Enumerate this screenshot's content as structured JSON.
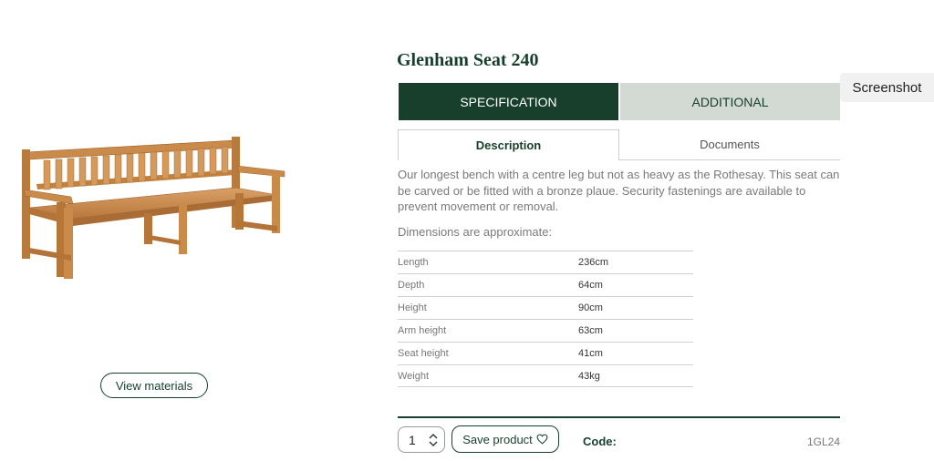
{
  "product": {
    "title": "Glenham Seat 240",
    "image_icon": "teak-bench-image",
    "view_materials_label": "View materials"
  },
  "overlay": {
    "screenshot_label": "Screenshot"
  },
  "tabs": {
    "main": [
      {
        "label": "SPECIFICATION",
        "active": true
      },
      {
        "label": "ADDITIONAL",
        "active": false
      }
    ],
    "sub": [
      {
        "label": "Description",
        "active": true
      },
      {
        "label": "Documents",
        "active": false
      }
    ]
  },
  "description": {
    "text": "Our longest bench with a centre leg but not as heavy as the Rothesay. This seat can be carved or be fitted with a bronze plaue. Security fastenings are available to prevent movement or removal.",
    "dimensions_heading": "Dimensions are approximate:"
  },
  "dimensions": [
    {
      "label": "Length",
      "value": "236cm"
    },
    {
      "label": "Depth",
      "value": "64cm"
    },
    {
      "label": "Height",
      "value": "90cm"
    },
    {
      "label": "Arm height",
      "value": "63cm"
    },
    {
      "label": "Seat height",
      "value": "41cm"
    },
    {
      "label": "Weight",
      "value": "43kg"
    }
  ],
  "purchase": {
    "quantity": "1",
    "save_label": "Save product",
    "save_icon": "heart-icon",
    "code_label": "Code:",
    "code_value": "1GL24"
  },
  "colors": {
    "brand_green": "#173f2c",
    "tab_inactive": "#d3d9d3",
    "teak": "#c98a4a"
  }
}
